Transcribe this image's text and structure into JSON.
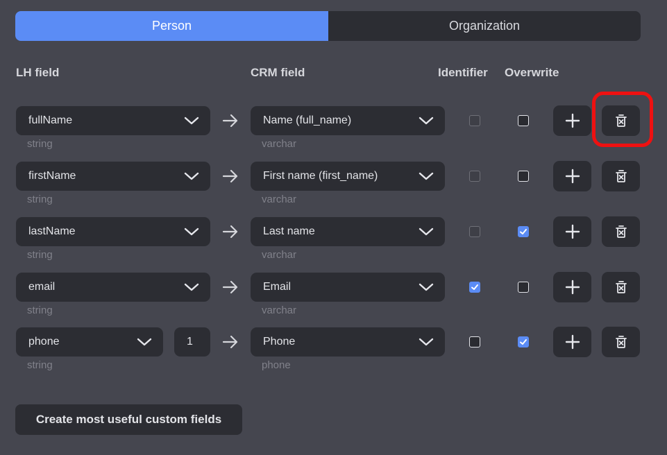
{
  "tabs": [
    {
      "label": "Person",
      "active": true
    },
    {
      "label": "Organization",
      "active": false
    }
  ],
  "headers": {
    "lh_field": "LH field",
    "crm_field": "CRM field",
    "identifier": "Identifier",
    "overwrite": "Overwrite"
  },
  "rows": [
    {
      "lh_field": "fullName",
      "lh_type": "string",
      "crm_field": "Name (full_name)",
      "crm_type": "varchar",
      "identifier": "disabled",
      "overwrite": false
    },
    {
      "lh_field": "firstName",
      "lh_type": "string",
      "crm_field": "First name (first_name)",
      "crm_type": "varchar",
      "identifier": "disabled",
      "overwrite": false
    },
    {
      "lh_field": "lastName",
      "lh_type": "string",
      "crm_field": "Last name",
      "crm_type": "varchar",
      "identifier": "disabled",
      "overwrite": true
    },
    {
      "lh_field": "email",
      "lh_type": "string",
      "crm_field": "Email",
      "crm_type": "varchar",
      "identifier": "checked",
      "overwrite": false
    },
    {
      "lh_field": "phone",
      "lh_type": "string",
      "lh_index": "1",
      "crm_field": "Phone",
      "crm_type": "phone",
      "identifier": "unchecked",
      "overwrite": true
    }
  ],
  "icons": {
    "dropdown": "chevron-down-icon",
    "mapping": "arrow-right-icon",
    "add": "plus-icon",
    "delete": "trash-icon"
  },
  "create_button_label": "Create most useful custom fields",
  "colors": {
    "background": "#45464f",
    "control": "#2c2d33",
    "accent": "#5b8cf5",
    "highlight": "#ee1111"
  }
}
